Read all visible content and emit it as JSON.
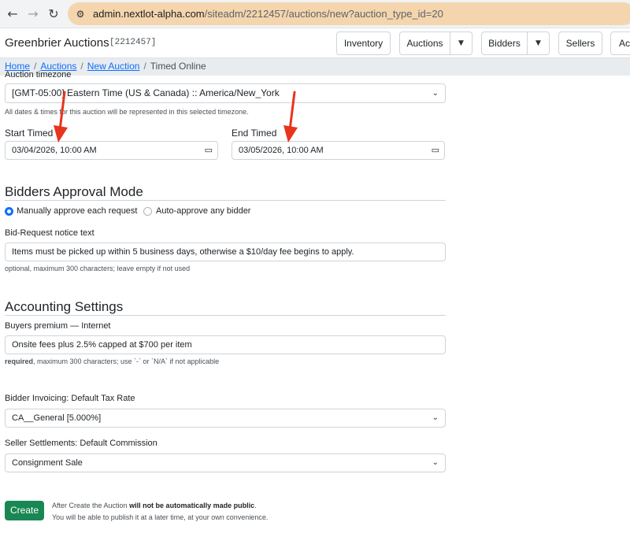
{
  "browser": {
    "url_host": "admin.nextlot-alpha.com",
    "url_path": "/siteadm/2212457/auctions/new?auction_type_id=20",
    "back_icon": "back-arrow-icon",
    "forward_icon": "forward-arrow-icon",
    "reload_icon": "reload-icon",
    "site_settings_icon": "site-settings-icon"
  },
  "header": {
    "brand": "Greenbrier Auctions",
    "site_id": "[2212457]",
    "nav": {
      "inventory": "Inventory",
      "auctions": "Auctions",
      "bidders": "Bidders",
      "sellers": "Sellers",
      "more": "Ac"
    }
  },
  "breadcrumb": {
    "home": "Home",
    "auctions": "Auctions",
    "new_auction": "New Auction",
    "current": "Timed Online",
    "sep": "/"
  },
  "form": {
    "timezone": {
      "label_partial": "Auction timezone",
      "value": "[GMT-05:00] Eastern Time (US & Canada) :: America/New_York",
      "help": "All dates & times for this auction will be represented in this selected timezone."
    },
    "start_timed": {
      "label": "Start Timed",
      "value": "03/04/2026, 10:00 AM"
    },
    "end_timed": {
      "label": "End Timed",
      "value": "03/05/2026, 10:00 AM"
    },
    "bidders_approval": {
      "title": "Bidders Approval Mode",
      "option_manual": "Manually approve each request",
      "option_auto": "Auto-approve any bidder",
      "selected": "manual"
    },
    "bid_request": {
      "label": "Bid-Request notice text",
      "value": "Items must be picked up within 5 business days, otherwise a $10/day fee begins to apply.",
      "help": "optional, maximum 300 characters; leave empty if not used"
    },
    "accounting": {
      "title": "Accounting Settings",
      "buyers_premium_label": "Buyers premium — Internet",
      "buyers_premium_value": "Onsite fees plus 2.5% capped at $700 per item",
      "help_required": "required",
      "help_rest": ", maximum 300 characters; use `-` or `N/A` if not applicable"
    },
    "tax_rate": {
      "label": "Bidder Invoicing: Default Tax Rate",
      "value": "CA__General [5.000%]"
    },
    "commission": {
      "label": "Seller Settlements: Default Commission",
      "value": "Consignment Sale"
    },
    "create_button": "Create",
    "note_line1_pre": "After Create the Auction ",
    "note_line1_bold": "will not be automatically made public",
    "note_line1_post": ".",
    "note_line2": "You will be able to publish it at a later time, at your own convenience."
  },
  "annotations": {
    "arrow_color": "#e8341c"
  },
  "colors": {
    "primary": "#0d6efd",
    "success": "#198754",
    "url_bar": "#f4d5ad"
  }
}
